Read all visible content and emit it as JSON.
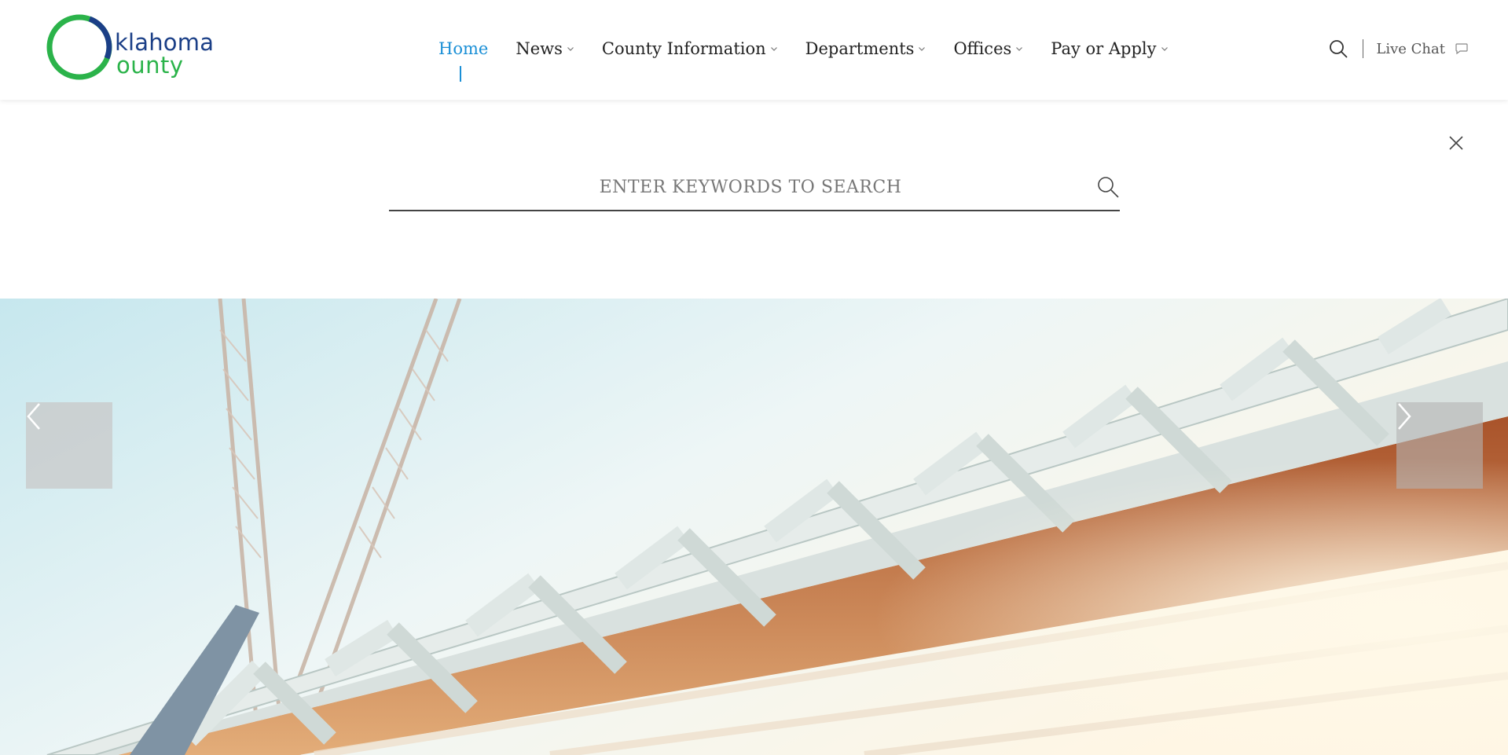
{
  "logo": {
    "word1": "klahoma",
    "word2": "ounty",
    "ring_green": "#2bb34a",
    "ring_blue": "#1b3f87"
  },
  "nav": {
    "items": [
      {
        "label": "Home",
        "active": true
      },
      {
        "label": "News",
        "has_dropdown": true
      },
      {
        "label": "County Information",
        "has_dropdown": true
      },
      {
        "label": "Departments",
        "has_dropdown": true
      },
      {
        "label": "Offices",
        "has_dropdown": true
      },
      {
        "label": "Pay or Apply",
        "has_dropdown": true
      }
    ],
    "accent": "#1a8fd6"
  },
  "header_right": {
    "search_icon": "search-icon",
    "live_chat_label": "Live Chat",
    "chat_icon": "chat-bubble-icon"
  },
  "search": {
    "placeholder": "ENTER KEYWORDS TO SEARCH",
    "value": "",
    "close_icon": "close-icon",
    "submit_icon": "search-icon"
  },
  "hero": {
    "prev_icon": "chevron-left-icon",
    "next_icon": "chevron-right-icon"
  }
}
